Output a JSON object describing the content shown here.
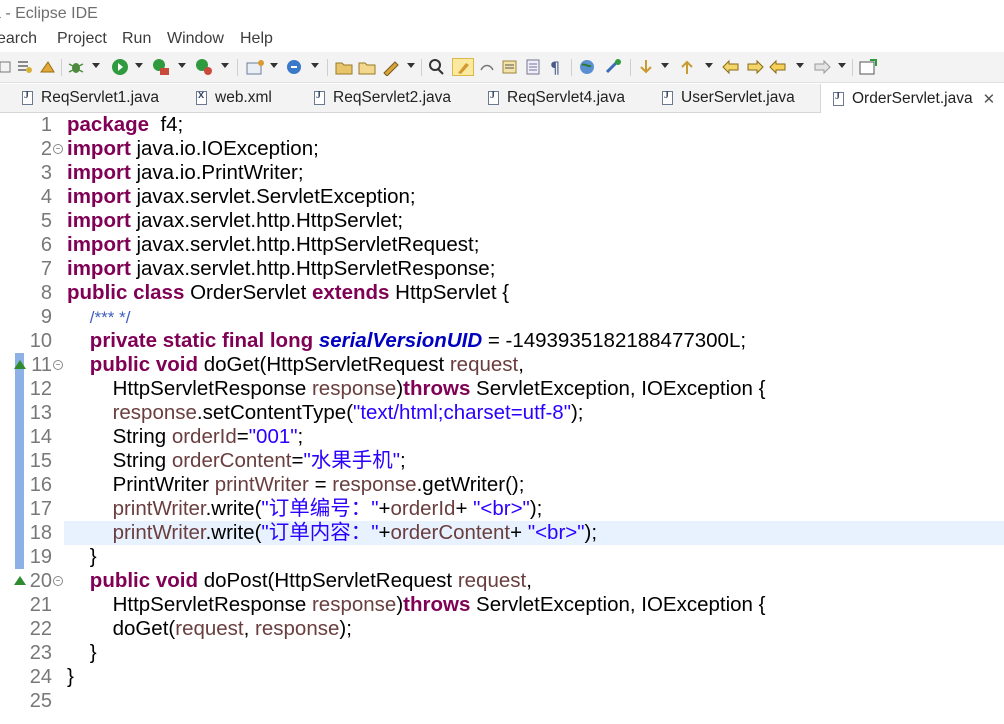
{
  "window": {
    "title": "a - Eclipse IDE"
  },
  "menu": [
    "earch",
    "Project",
    "Run",
    "Window",
    "Help"
  ],
  "toolbar": {
    "icons": [
      "open-type-icon",
      "gear-icon",
      "bug-debug-icon",
      "run-icon",
      "coverage-icon",
      "external-tools-icon",
      "new-java-project-icon",
      "new-class-icon",
      "open-folder-icon",
      "pencil-icon",
      "search-icon",
      "pin-icon",
      "edit-icon",
      "block-icon",
      "paragraph-icon",
      "globe-icon",
      "tool-icon",
      "next-annotation-icon",
      "prev-annotation-icon",
      "back-edit-icon",
      "forward-edit-icon",
      "back-icon",
      "forward-icon",
      "perspective-icon"
    ]
  },
  "tabs": [
    {
      "label": "ReqServlet1.java",
      "type": "java"
    },
    {
      "label": "web.xml",
      "type": "xml"
    },
    {
      "label": "ReqServlet2.java",
      "type": "java"
    },
    {
      "label": "ReqServlet4.java",
      "type": "java"
    },
    {
      "label": "UserServlet.java",
      "type": "java"
    },
    {
      "label": "OrderServlet.java",
      "type": "java",
      "active": true
    }
  ],
  "side_fragment": "5",
  "editor": {
    "highlight_line": 18,
    "lines": [
      {
        "n": "1",
        "tokens": [
          [
            "kw",
            "package"
          ],
          [
            "",
            "  f4;"
          ]
        ]
      },
      {
        "n": "2",
        "fold": true,
        "tokens": [
          [
            "kw",
            "import"
          ],
          [
            "",
            " java.io.IOException;"
          ]
        ]
      },
      {
        "n": "3",
        "tokens": [
          [
            "kw",
            "import"
          ],
          [
            "",
            " java.io.PrintWriter;"
          ]
        ]
      },
      {
        "n": "4",
        "tokens": [
          [
            "kw",
            "import"
          ],
          [
            "",
            " javax.servlet.ServletException;"
          ]
        ]
      },
      {
        "n": "5",
        "tokens": [
          [
            "kw",
            "import"
          ],
          [
            "",
            " javax.servlet.http.HttpServlet;"
          ]
        ]
      },
      {
        "n": "6",
        "tokens": [
          [
            "kw",
            "import"
          ],
          [
            "",
            " javax.servlet.http.HttpServletRequest;"
          ]
        ]
      },
      {
        "n": "7",
        "tokens": [
          [
            "kw",
            "import"
          ],
          [
            "",
            " javax.servlet.http.HttpServletResponse;"
          ]
        ]
      },
      {
        "n": "8",
        "tokens": [
          [
            "kw",
            "public"
          ],
          [
            "",
            " "
          ],
          [
            "kw",
            "class"
          ],
          [
            "",
            " OrderServlet "
          ],
          [
            "kw",
            "extends"
          ],
          [
            "",
            " HttpServlet {"
          ]
        ]
      },
      {
        "n": "9",
        "tokens": [
          [
            "",
            "    "
          ],
          [
            "cmt",
            "/*** */"
          ]
        ]
      },
      {
        "n": "10",
        "tokens": [
          [
            "",
            "    "
          ],
          [
            "kw",
            "private"
          ],
          [
            "",
            " "
          ],
          [
            "kw",
            "static"
          ],
          [
            "",
            " "
          ],
          [
            "kw",
            "final"
          ],
          [
            "",
            " "
          ],
          [
            "kw",
            "long"
          ],
          [
            "",
            " "
          ],
          [
            "fld",
            "serialVersionUID"
          ],
          [
            "",
            " = -1493935182188477300L;"
          ]
        ]
      },
      {
        "n": "11",
        "fold": true,
        "override": true,
        "tokens": [
          [
            "",
            "    "
          ],
          [
            "kw",
            "public"
          ],
          [
            "",
            " "
          ],
          [
            "kw",
            "void"
          ],
          [
            "",
            " doGet(HttpServletRequest "
          ],
          [
            "var",
            "request"
          ],
          [
            "",
            ","
          ]
        ]
      },
      {
        "n": "12",
        "tokens": [
          [
            "",
            "        HttpServletResponse "
          ],
          [
            "var",
            "response"
          ],
          [
            "",
            ")"
          ],
          [
            "kw",
            "throws"
          ],
          [
            "",
            " ServletException, IOException {"
          ]
        ]
      },
      {
        "n": "13",
        "tokens": [
          [
            "",
            "        "
          ],
          [
            "var",
            "response"
          ],
          [
            "",
            ".setContentType("
          ],
          [
            "str",
            "\"text/html;charset=utf-8\""
          ],
          [
            "",
            ");"
          ]
        ]
      },
      {
        "n": "14",
        "tokens": [
          [
            "",
            "        String "
          ],
          [
            "var",
            "orderId"
          ],
          [
            "",
            "="
          ],
          [
            "str",
            "\"001\""
          ],
          [
            "",
            ";"
          ]
        ]
      },
      {
        "n": "15",
        "tokens": [
          [
            "",
            "        String "
          ],
          [
            "var",
            "orderContent"
          ],
          [
            "",
            "="
          ],
          [
            "str",
            "\"水果手机\""
          ],
          [
            "",
            ";"
          ]
        ]
      },
      {
        "n": "16",
        "tokens": [
          [
            "",
            "        PrintWriter "
          ],
          [
            "var",
            "printWriter"
          ],
          [
            "",
            " = "
          ],
          [
            "var",
            "response"
          ],
          [
            "",
            ".getWriter();"
          ]
        ]
      },
      {
        "n": "17",
        "tokens": [
          [
            "",
            "        "
          ],
          [
            "var",
            "printWriter"
          ],
          [
            "",
            ".write("
          ],
          [
            "str",
            "\"订单编号：\""
          ],
          [
            "",
            "+"
          ],
          [
            "var",
            "orderId"
          ],
          [
            "",
            "+ "
          ],
          [
            "str",
            "\"<br>\""
          ],
          [
            "",
            ");"
          ]
        ]
      },
      {
        "n": "18",
        "tokens": [
          [
            "",
            "        "
          ],
          [
            "var",
            "printWriter"
          ],
          [
            "",
            ".write("
          ],
          [
            "str",
            "\"订单内容：\""
          ],
          [
            "",
            "+"
          ],
          [
            "var",
            "orderContent"
          ],
          [
            "",
            "+ "
          ],
          [
            "str",
            "\"<br>\""
          ],
          [
            "",
            ");"
          ]
        ]
      },
      {
        "n": "19",
        "tokens": [
          [
            "",
            "    }"
          ]
        ]
      },
      {
        "n": "20",
        "fold": true,
        "override": true,
        "tokens": [
          [
            "",
            "    "
          ],
          [
            "kw",
            "public"
          ],
          [
            "",
            " "
          ],
          [
            "kw",
            "void"
          ],
          [
            "",
            " doPost(HttpServletRequest "
          ],
          [
            "var",
            "request"
          ],
          [
            "",
            ","
          ]
        ]
      },
      {
        "n": "21",
        "tokens": [
          [
            "",
            "        HttpServletResponse "
          ],
          [
            "var",
            "response"
          ],
          [
            "",
            ")"
          ],
          [
            "kw",
            "throws"
          ],
          [
            "",
            " ServletException, IOException {"
          ]
        ]
      },
      {
        "n": "22",
        "tokens": [
          [
            "",
            "        doGet("
          ],
          [
            "var",
            "request"
          ],
          [
            "",
            ", "
          ],
          [
            "var",
            "response"
          ],
          [
            "",
            ");"
          ]
        ]
      },
      {
        "n": "23",
        "tokens": [
          [
            "",
            "    }"
          ]
        ]
      },
      {
        "n": "24",
        "tokens": [
          [
            "",
            "}"
          ]
        ]
      },
      {
        "n": "25",
        "tokens": []
      }
    ]
  }
}
